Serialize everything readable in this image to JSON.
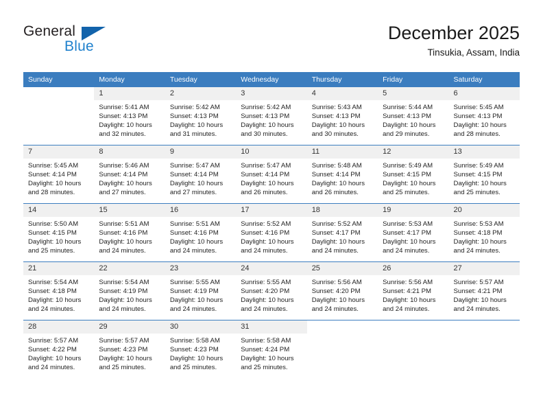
{
  "logo": {
    "text_top": "General",
    "text_bottom": "Blue",
    "triangle_color": "#1263ab",
    "blue_color": "#2081cd"
  },
  "header": {
    "title": "December 2025",
    "subtitle": "Tinsukia, Assam, India"
  },
  "theme": {
    "header_blue": "#3b7dbf",
    "daynum_band": "#f0f0f0"
  },
  "weekday_headers": [
    "Sunday",
    "Monday",
    "Tuesday",
    "Wednesday",
    "Thursday",
    "Friday",
    "Saturday"
  ],
  "weeks": [
    [
      {
        "day": "",
        "empty": true,
        "sunrise": "",
        "sunset": "",
        "daylight": ""
      },
      {
        "day": "1",
        "sunrise": "Sunrise: 5:41 AM",
        "sunset": "Sunset: 4:13 PM",
        "daylight": "Daylight: 10 hours and 32 minutes."
      },
      {
        "day": "2",
        "sunrise": "Sunrise: 5:42 AM",
        "sunset": "Sunset: 4:13 PM",
        "daylight": "Daylight: 10 hours and 31 minutes."
      },
      {
        "day": "3",
        "sunrise": "Sunrise: 5:42 AM",
        "sunset": "Sunset: 4:13 PM",
        "daylight": "Daylight: 10 hours and 30 minutes."
      },
      {
        "day": "4",
        "sunrise": "Sunrise: 5:43 AM",
        "sunset": "Sunset: 4:13 PM",
        "daylight": "Daylight: 10 hours and 30 minutes."
      },
      {
        "day": "5",
        "sunrise": "Sunrise: 5:44 AM",
        "sunset": "Sunset: 4:13 PM",
        "daylight": "Daylight: 10 hours and 29 minutes."
      },
      {
        "day": "6",
        "sunrise": "Sunrise: 5:45 AM",
        "sunset": "Sunset: 4:13 PM",
        "daylight": "Daylight: 10 hours and 28 minutes."
      }
    ],
    [
      {
        "day": "7",
        "sunrise": "Sunrise: 5:45 AM",
        "sunset": "Sunset: 4:14 PM",
        "daylight": "Daylight: 10 hours and 28 minutes."
      },
      {
        "day": "8",
        "sunrise": "Sunrise: 5:46 AM",
        "sunset": "Sunset: 4:14 PM",
        "daylight": "Daylight: 10 hours and 27 minutes."
      },
      {
        "day": "9",
        "sunrise": "Sunrise: 5:47 AM",
        "sunset": "Sunset: 4:14 PM",
        "daylight": "Daylight: 10 hours and 27 minutes."
      },
      {
        "day": "10",
        "sunrise": "Sunrise: 5:47 AM",
        "sunset": "Sunset: 4:14 PM",
        "daylight": "Daylight: 10 hours and 26 minutes."
      },
      {
        "day": "11",
        "sunrise": "Sunrise: 5:48 AM",
        "sunset": "Sunset: 4:14 PM",
        "daylight": "Daylight: 10 hours and 26 minutes."
      },
      {
        "day": "12",
        "sunrise": "Sunrise: 5:49 AM",
        "sunset": "Sunset: 4:15 PM",
        "daylight": "Daylight: 10 hours and 25 minutes."
      },
      {
        "day": "13",
        "sunrise": "Sunrise: 5:49 AM",
        "sunset": "Sunset: 4:15 PM",
        "daylight": "Daylight: 10 hours and 25 minutes."
      }
    ],
    [
      {
        "day": "14",
        "sunrise": "Sunrise: 5:50 AM",
        "sunset": "Sunset: 4:15 PM",
        "daylight": "Daylight: 10 hours and 25 minutes."
      },
      {
        "day": "15",
        "sunrise": "Sunrise: 5:51 AM",
        "sunset": "Sunset: 4:16 PM",
        "daylight": "Daylight: 10 hours and 24 minutes."
      },
      {
        "day": "16",
        "sunrise": "Sunrise: 5:51 AM",
        "sunset": "Sunset: 4:16 PM",
        "daylight": "Daylight: 10 hours and 24 minutes."
      },
      {
        "day": "17",
        "sunrise": "Sunrise: 5:52 AM",
        "sunset": "Sunset: 4:16 PM",
        "daylight": "Daylight: 10 hours and 24 minutes."
      },
      {
        "day": "18",
        "sunrise": "Sunrise: 5:52 AM",
        "sunset": "Sunset: 4:17 PM",
        "daylight": "Daylight: 10 hours and 24 minutes."
      },
      {
        "day": "19",
        "sunrise": "Sunrise: 5:53 AM",
        "sunset": "Sunset: 4:17 PM",
        "daylight": "Daylight: 10 hours and 24 minutes."
      },
      {
        "day": "20",
        "sunrise": "Sunrise: 5:53 AM",
        "sunset": "Sunset: 4:18 PM",
        "daylight": "Daylight: 10 hours and 24 minutes."
      }
    ],
    [
      {
        "day": "21",
        "sunrise": "Sunrise: 5:54 AM",
        "sunset": "Sunset: 4:18 PM",
        "daylight": "Daylight: 10 hours and 24 minutes."
      },
      {
        "day": "22",
        "sunrise": "Sunrise: 5:54 AM",
        "sunset": "Sunset: 4:19 PM",
        "daylight": "Daylight: 10 hours and 24 minutes."
      },
      {
        "day": "23",
        "sunrise": "Sunrise: 5:55 AM",
        "sunset": "Sunset: 4:19 PM",
        "daylight": "Daylight: 10 hours and 24 minutes."
      },
      {
        "day": "24",
        "sunrise": "Sunrise: 5:55 AM",
        "sunset": "Sunset: 4:20 PM",
        "daylight": "Daylight: 10 hours and 24 minutes."
      },
      {
        "day": "25",
        "sunrise": "Sunrise: 5:56 AM",
        "sunset": "Sunset: 4:20 PM",
        "daylight": "Daylight: 10 hours and 24 minutes."
      },
      {
        "day": "26",
        "sunrise": "Sunrise: 5:56 AM",
        "sunset": "Sunset: 4:21 PM",
        "daylight": "Daylight: 10 hours and 24 minutes."
      },
      {
        "day": "27",
        "sunrise": "Sunrise: 5:57 AM",
        "sunset": "Sunset: 4:21 PM",
        "daylight": "Daylight: 10 hours and 24 minutes."
      }
    ],
    [
      {
        "day": "28",
        "sunrise": "Sunrise: 5:57 AM",
        "sunset": "Sunset: 4:22 PM",
        "daylight": "Daylight: 10 hours and 24 minutes."
      },
      {
        "day": "29",
        "sunrise": "Sunrise: 5:57 AM",
        "sunset": "Sunset: 4:23 PM",
        "daylight": "Daylight: 10 hours and 25 minutes."
      },
      {
        "day": "30",
        "sunrise": "Sunrise: 5:58 AM",
        "sunset": "Sunset: 4:23 PM",
        "daylight": "Daylight: 10 hours and 25 minutes."
      },
      {
        "day": "31",
        "sunrise": "Sunrise: 5:58 AM",
        "sunset": "Sunset: 4:24 PM",
        "daylight": "Daylight: 10 hours and 25 minutes."
      },
      {
        "day": "",
        "empty": true,
        "sunrise": "",
        "sunset": "",
        "daylight": ""
      },
      {
        "day": "",
        "empty": true,
        "sunrise": "",
        "sunset": "",
        "daylight": ""
      },
      {
        "day": "",
        "empty": true,
        "sunrise": "",
        "sunset": "",
        "daylight": ""
      }
    ]
  ]
}
